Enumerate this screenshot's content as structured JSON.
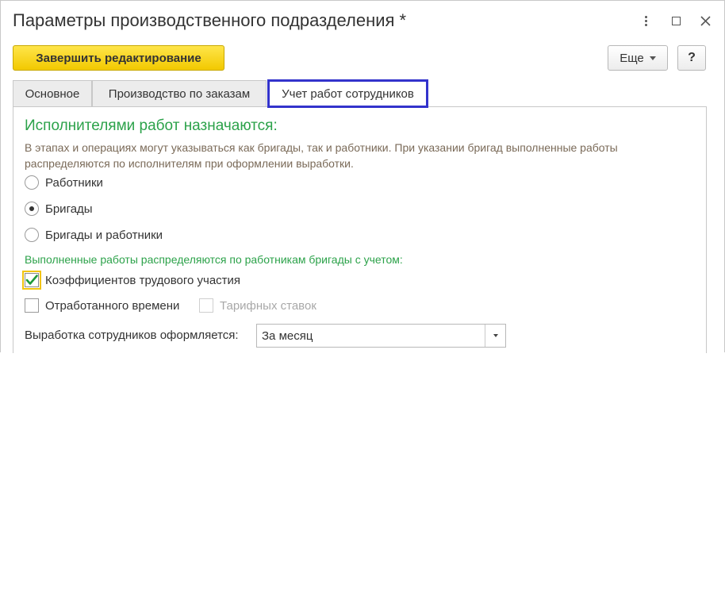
{
  "window": {
    "title": "Параметры производственного подразделения *"
  },
  "toolbar": {
    "finish_label": "Завершить редактирование",
    "more_label": "Еще",
    "help_label": "?"
  },
  "tabs": [
    {
      "label": "Основное",
      "active": false
    },
    {
      "label": "Производство по заказам",
      "active": false
    },
    {
      "label": "Учет работ сотрудников",
      "active": true
    }
  ],
  "section": {
    "heading": "Исполнителями работ назначаются:",
    "hint": "В этапах и операциях могут указываться как бригады, так и работники. При указании бригад выполненные работы распределяются по исполнителям при оформлении выработки."
  },
  "performers": {
    "options": [
      {
        "label": "Работники",
        "selected": false
      },
      {
        "label": "Бригады",
        "selected": true
      },
      {
        "label": "Бригады и работники",
        "selected": false
      }
    ]
  },
  "distribution": {
    "heading": "Выполненные работы распределяются по работникам бригады с учетом:",
    "options": [
      {
        "label": "Коэффициентов трудового участия",
        "checked": true,
        "enabled": true
      },
      {
        "label": "Отработанного времени",
        "checked": false,
        "enabled": true
      },
      {
        "label": "Тарифных ставок",
        "checked": false,
        "enabled": false
      }
    ]
  },
  "output": {
    "label": "Выработка сотрудников оформляется:",
    "value": "За месяц"
  },
  "colors": {
    "accent_green": "#2ca24a",
    "finish_button": "#f5d21c",
    "active_tab_border": "#3333cc",
    "checkmark": "#1f9a3a",
    "focus_outline": "#f1c40f"
  }
}
